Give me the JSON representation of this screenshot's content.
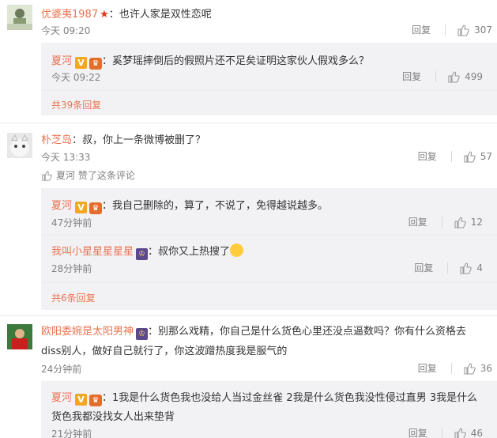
{
  "c1": {
    "user": "优婆夷1987",
    "text": "：也许人家是双性恋呢",
    "time": "今天 09:20",
    "reply_label": "回复",
    "likes": "307",
    "reply": {
      "user": "夏河",
      "text": "：奚梦瑶摔倒后的假照片还不足矣证明这家伙人假戏多么？",
      "time": "今天 09:22",
      "reply_label": "回复",
      "likes": "499"
    },
    "more": "共39条回复"
  },
  "c2": {
    "user": "朴芝岛",
    "text": "：叔，你上一条微博被删了？",
    "time": "今天 13:33",
    "reply_label": "回复",
    "likes": "57",
    "liked_by": "夏河 赞了这条评论",
    "reply1": {
      "user": "夏河",
      "text": "：我自己删除的，算了，不说了，免得越说越多。",
      "time": "47分钟前",
      "reply_label": "回复",
      "likes": "12"
    },
    "reply2": {
      "user": "我叫小星星星星星",
      "text": "：叔你又上热搜了",
      "time": "28分钟前",
      "reply_label": "回复",
      "likes": "4"
    },
    "more": "共6条回复"
  },
  "c3": {
    "user": "欧阳委婉是太阳男神",
    "text_line1": "：别那么戏精，你自己是什么货色心里还没点逼数吗？你有什么资格去",
    "text_line2": "diss别人，做好自己就行了，你这波蹭热度我是服气的",
    "time": "24分钟前",
    "reply_label": "回复",
    "likes": "36",
    "reply": {
      "user": "夏河",
      "text_line1": "：1我是什么货色我也没给人当过金丝雀 2我是什么货色我没性侵过直男 3我是什么",
      "text_line2": "货色我都没找女人出来垫背",
      "time": "21分钟前",
      "reply_label": "回复",
      "likes": "46"
    }
  },
  "icons": {
    "v_badge": "V",
    "vip_badge": "♛",
    "star": "★",
    "thumb": "thumb-up-icon"
  },
  "colors": {
    "username": "#eb7350",
    "text": "#333333",
    "meta": "#808080",
    "reply_bg": "#f2f2f5"
  }
}
